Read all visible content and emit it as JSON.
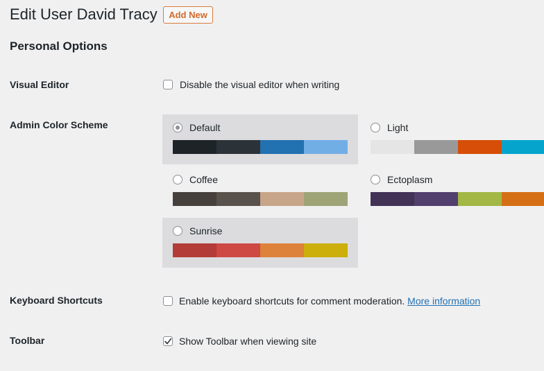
{
  "header": {
    "title": "Edit User David Tracy",
    "add_new_label": "Add New"
  },
  "section_title": "Personal Options",
  "visual_editor": {
    "label": "Visual Editor",
    "checkbox_label": "Disable the visual editor when writing",
    "checked": false
  },
  "color_scheme": {
    "label": "Admin Color Scheme",
    "selected": "Default",
    "schemes": [
      {
        "name": "Default",
        "colors": [
          "#1d2327",
          "#2c3338",
          "#2271b1",
          "#72aee6"
        ],
        "checked": true
      },
      {
        "name": "Light",
        "colors": [
          "#e5e5e5",
          "#999999",
          "#d64e07",
          "#04a4cc"
        ],
        "checked": false
      },
      {
        "name": "Coffee",
        "colors": [
          "#46403c",
          "#59524c",
          "#c7a589",
          "#9ea476"
        ],
        "checked": false
      },
      {
        "name": "Ectoplasm",
        "colors": [
          "#413256",
          "#523f6d",
          "#a3b745",
          "#d46f15"
        ],
        "checked": false
      },
      {
        "name": "Sunrise",
        "colors": [
          "#b43c38",
          "#cf4944",
          "#dd823b",
          "#ccaf0b"
        ],
        "checked": false
      }
    ]
  },
  "keyboard_shortcuts": {
    "label": "Keyboard Shortcuts",
    "checkbox_label": "Enable keyboard shortcuts for comment moderation.",
    "link_label": "More information",
    "checked": false
  },
  "toolbar": {
    "label": "Toolbar",
    "checkbox_label": "Show Toolbar when viewing site",
    "checked": true
  },
  "colors": {
    "accent": "#2271b1",
    "add_new": "#d2692a",
    "selected_bg": "#dcdcde"
  }
}
